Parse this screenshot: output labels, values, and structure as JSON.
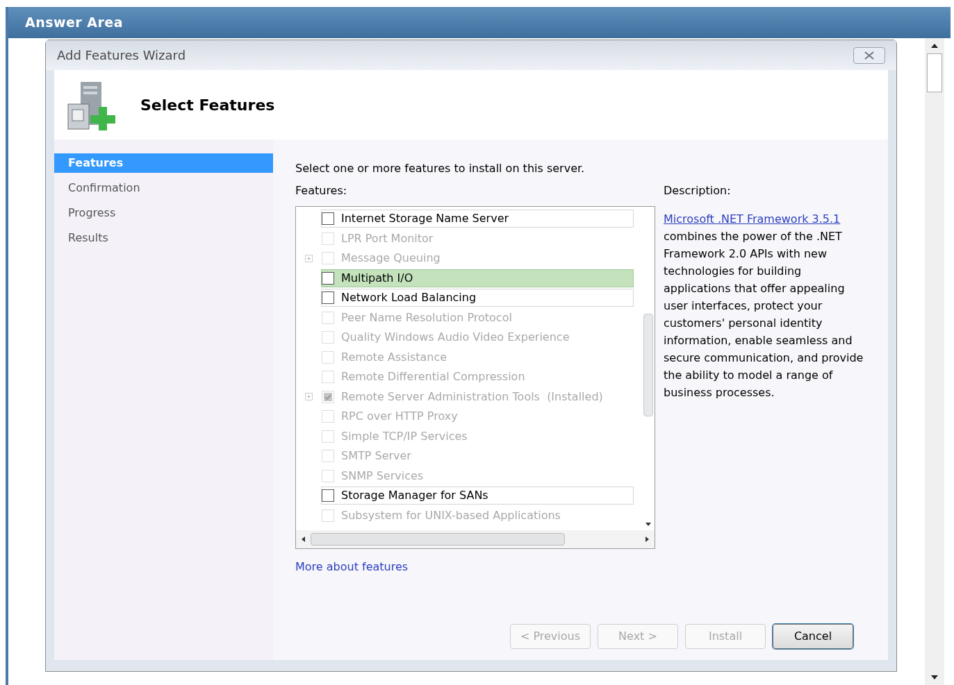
{
  "outer_window": {
    "title": "Answer Area"
  },
  "dialog": {
    "title": "Add Features Wizard",
    "heading": "Select Features"
  },
  "steps": [
    {
      "label": "Features",
      "selected": true
    },
    {
      "label": "Confirmation",
      "selected": false
    },
    {
      "label": "Progress",
      "selected": false
    },
    {
      "label": "Results",
      "selected": false
    }
  ],
  "instruction": "Select one or more features to install on this server.",
  "features_label": "Features:",
  "features": [
    {
      "label": "Internet Storage Name Server",
      "enabled": true,
      "checked": false,
      "selected": false,
      "expandable": false
    },
    {
      "label": "LPR Port Monitor",
      "enabled": false,
      "checked": false,
      "selected": false,
      "expandable": false
    },
    {
      "label": "Message Queuing",
      "enabled": false,
      "checked": false,
      "selected": false,
      "expandable": true
    },
    {
      "label": "Multipath I/O",
      "enabled": true,
      "checked": false,
      "selected": true,
      "expandable": false
    },
    {
      "label": "Network Load Balancing",
      "enabled": true,
      "checked": false,
      "selected": false,
      "expandable": false
    },
    {
      "label": "Peer Name Resolution Protocol",
      "enabled": false,
      "checked": false,
      "selected": false,
      "expandable": false
    },
    {
      "label": "Quality Windows Audio Video Experience",
      "enabled": false,
      "checked": false,
      "selected": false,
      "expandable": false
    },
    {
      "label": "Remote Assistance",
      "enabled": false,
      "checked": false,
      "selected": false,
      "expandable": false
    },
    {
      "label": "Remote Differential Compression",
      "enabled": false,
      "checked": false,
      "selected": false,
      "expandable": false
    },
    {
      "label": "Remote Server Administration Tools  (Installed)",
      "enabled": false,
      "checked": true,
      "selected": false,
      "expandable": true
    },
    {
      "label": "RPC over HTTP Proxy",
      "enabled": false,
      "checked": false,
      "selected": false,
      "expandable": false
    },
    {
      "label": "Simple TCP/IP Services",
      "enabled": false,
      "checked": false,
      "selected": false,
      "expandable": false
    },
    {
      "label": "SMTP Server",
      "enabled": false,
      "checked": false,
      "selected": false,
      "expandable": false
    },
    {
      "label": "SNMP Services",
      "enabled": false,
      "checked": false,
      "selected": false,
      "expandable": false
    },
    {
      "label": "Storage Manager for SANs",
      "enabled": true,
      "checked": false,
      "selected": false,
      "expandable": false
    },
    {
      "label": "Subsystem for UNIX-based Applications",
      "enabled": false,
      "checked": false,
      "selected": false,
      "expandable": false
    }
  ],
  "description": {
    "label": "Description:",
    "link": "Microsoft .NET Framework 3.5.1",
    "text": "combines the power of the .NET Framework 2.0 APIs with new technologies for building applications that offer appealing user interfaces, protect your customers' personal identity information, enable seamless and secure communication, and provide the ability to model a range of business processes."
  },
  "more_link": "More about features",
  "buttons": [
    {
      "label": "< Previous",
      "disabled": true,
      "default": false
    },
    {
      "label": "Next >",
      "disabled": true,
      "default": false
    },
    {
      "label": "Install",
      "disabled": true,
      "default": false
    },
    {
      "label": "Cancel",
      "disabled": false,
      "default": true
    }
  ]
}
